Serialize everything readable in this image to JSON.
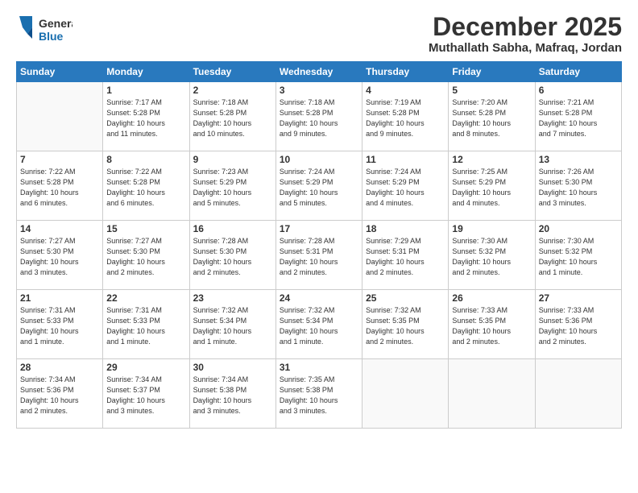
{
  "header": {
    "logo_general": "General",
    "logo_blue": "Blue",
    "month": "December 2025",
    "location": "Muthallath Sabha, Mafraq, Jordan"
  },
  "weekdays": [
    "Sunday",
    "Monday",
    "Tuesday",
    "Wednesday",
    "Thursday",
    "Friday",
    "Saturday"
  ],
  "weeks": [
    [
      {
        "day": "",
        "info": ""
      },
      {
        "day": "1",
        "info": "Sunrise: 7:17 AM\nSunset: 5:28 PM\nDaylight: 10 hours\nand 11 minutes."
      },
      {
        "day": "2",
        "info": "Sunrise: 7:18 AM\nSunset: 5:28 PM\nDaylight: 10 hours\nand 10 minutes."
      },
      {
        "day": "3",
        "info": "Sunrise: 7:18 AM\nSunset: 5:28 PM\nDaylight: 10 hours\nand 9 minutes."
      },
      {
        "day": "4",
        "info": "Sunrise: 7:19 AM\nSunset: 5:28 PM\nDaylight: 10 hours\nand 9 minutes."
      },
      {
        "day": "5",
        "info": "Sunrise: 7:20 AM\nSunset: 5:28 PM\nDaylight: 10 hours\nand 8 minutes."
      },
      {
        "day": "6",
        "info": "Sunrise: 7:21 AM\nSunset: 5:28 PM\nDaylight: 10 hours\nand 7 minutes."
      }
    ],
    [
      {
        "day": "7",
        "info": "Sunrise: 7:22 AM\nSunset: 5:28 PM\nDaylight: 10 hours\nand 6 minutes."
      },
      {
        "day": "8",
        "info": "Sunrise: 7:22 AM\nSunset: 5:28 PM\nDaylight: 10 hours\nand 6 minutes."
      },
      {
        "day": "9",
        "info": "Sunrise: 7:23 AM\nSunset: 5:29 PM\nDaylight: 10 hours\nand 5 minutes."
      },
      {
        "day": "10",
        "info": "Sunrise: 7:24 AM\nSunset: 5:29 PM\nDaylight: 10 hours\nand 5 minutes."
      },
      {
        "day": "11",
        "info": "Sunrise: 7:24 AM\nSunset: 5:29 PM\nDaylight: 10 hours\nand 4 minutes."
      },
      {
        "day": "12",
        "info": "Sunrise: 7:25 AM\nSunset: 5:29 PM\nDaylight: 10 hours\nand 4 minutes."
      },
      {
        "day": "13",
        "info": "Sunrise: 7:26 AM\nSunset: 5:30 PM\nDaylight: 10 hours\nand 3 minutes."
      }
    ],
    [
      {
        "day": "14",
        "info": "Sunrise: 7:27 AM\nSunset: 5:30 PM\nDaylight: 10 hours\nand 3 minutes."
      },
      {
        "day": "15",
        "info": "Sunrise: 7:27 AM\nSunset: 5:30 PM\nDaylight: 10 hours\nand 2 minutes."
      },
      {
        "day": "16",
        "info": "Sunrise: 7:28 AM\nSunset: 5:30 PM\nDaylight: 10 hours\nand 2 minutes."
      },
      {
        "day": "17",
        "info": "Sunrise: 7:28 AM\nSunset: 5:31 PM\nDaylight: 10 hours\nand 2 minutes."
      },
      {
        "day": "18",
        "info": "Sunrise: 7:29 AM\nSunset: 5:31 PM\nDaylight: 10 hours\nand 2 minutes."
      },
      {
        "day": "19",
        "info": "Sunrise: 7:30 AM\nSunset: 5:32 PM\nDaylight: 10 hours\nand 2 minutes."
      },
      {
        "day": "20",
        "info": "Sunrise: 7:30 AM\nSunset: 5:32 PM\nDaylight: 10 hours\nand 1 minute."
      }
    ],
    [
      {
        "day": "21",
        "info": "Sunrise: 7:31 AM\nSunset: 5:33 PM\nDaylight: 10 hours\nand 1 minute."
      },
      {
        "day": "22",
        "info": "Sunrise: 7:31 AM\nSunset: 5:33 PM\nDaylight: 10 hours\nand 1 minute."
      },
      {
        "day": "23",
        "info": "Sunrise: 7:32 AM\nSunset: 5:34 PM\nDaylight: 10 hours\nand 1 minute."
      },
      {
        "day": "24",
        "info": "Sunrise: 7:32 AM\nSunset: 5:34 PM\nDaylight: 10 hours\nand 1 minute."
      },
      {
        "day": "25",
        "info": "Sunrise: 7:32 AM\nSunset: 5:35 PM\nDaylight: 10 hours\nand 2 minutes."
      },
      {
        "day": "26",
        "info": "Sunrise: 7:33 AM\nSunset: 5:35 PM\nDaylight: 10 hours\nand 2 minutes."
      },
      {
        "day": "27",
        "info": "Sunrise: 7:33 AM\nSunset: 5:36 PM\nDaylight: 10 hours\nand 2 minutes."
      }
    ],
    [
      {
        "day": "28",
        "info": "Sunrise: 7:34 AM\nSunset: 5:36 PM\nDaylight: 10 hours\nand 2 minutes."
      },
      {
        "day": "29",
        "info": "Sunrise: 7:34 AM\nSunset: 5:37 PM\nDaylight: 10 hours\nand 3 minutes."
      },
      {
        "day": "30",
        "info": "Sunrise: 7:34 AM\nSunset: 5:38 PM\nDaylight: 10 hours\nand 3 minutes."
      },
      {
        "day": "31",
        "info": "Sunrise: 7:35 AM\nSunset: 5:38 PM\nDaylight: 10 hours\nand 3 minutes."
      },
      {
        "day": "",
        "info": ""
      },
      {
        "day": "",
        "info": ""
      },
      {
        "day": "",
        "info": ""
      }
    ]
  ]
}
